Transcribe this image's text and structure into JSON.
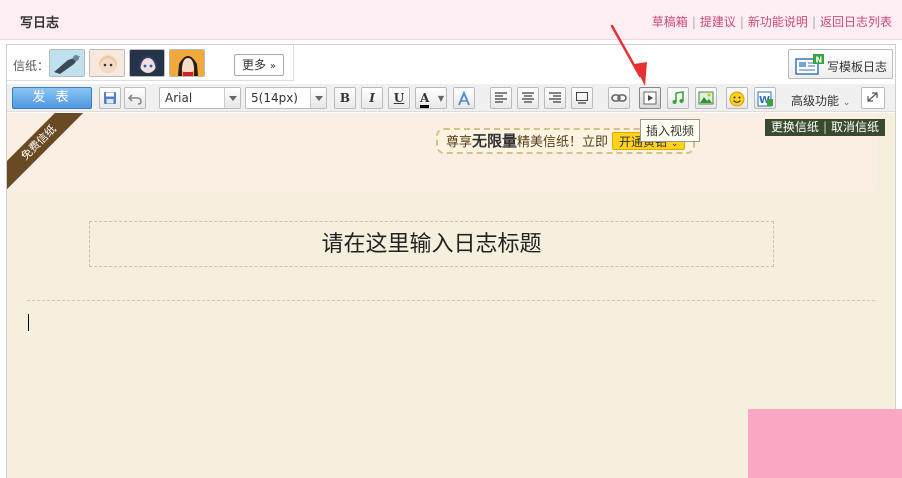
{
  "header": {
    "title": "写日志",
    "links": [
      "草稿箱",
      "提建议",
      "新功能说明",
      "返回日志列表"
    ]
  },
  "stationery": {
    "label": "信纸：",
    "more_label": "更多"
  },
  "template_button": {
    "label": "写模板日志"
  },
  "toolbar": {
    "publish_label": "发 表",
    "font_family": "Arial",
    "font_size": "5(14px)",
    "bold": "B",
    "italic": "I",
    "underline": "U",
    "font_color": "A",
    "advanced_label": "高级功能"
  },
  "tooltip": {
    "text": "插入视频"
  },
  "paper": {
    "ribbon_text": "免费信纸",
    "promo_prefix": "尊享",
    "promo_bold": "无限量",
    "promo_suffix": "精美信纸！立即",
    "promo_button": "开通黄钻",
    "change_paper": "更换信纸",
    "cancel_paper": "取消信纸"
  },
  "editor": {
    "title_placeholder": "请在这里输入日志标题"
  },
  "colors": {
    "header_bg": "#fdeef3",
    "link": "#c8497d",
    "publish_bg": "#4e98e0",
    "paper_bg": "#f5f0dd",
    "vip_yellow": "#ffd21e",
    "annotation_arrow": "#e63232"
  }
}
